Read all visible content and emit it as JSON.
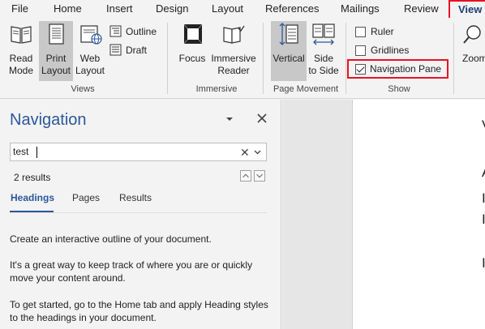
{
  "ribbon_tabs": [
    "File",
    "Home",
    "Insert",
    "Design",
    "Layout",
    "References",
    "Mailings",
    "Review",
    "View"
  ],
  "ribbon": {
    "views": {
      "label": "Views",
      "read_mode": [
        "Read",
        "Mode"
      ],
      "print_layout": [
        "Print",
        "Layout"
      ],
      "web_layout": [
        "Web",
        "Layout"
      ],
      "outline": "Outline",
      "draft": "Draft"
    },
    "immersive": {
      "label": "Immersive",
      "focus": "Focus",
      "immersive_reader": [
        "Immersive",
        "Reader"
      ]
    },
    "page_movement": {
      "label": "Page Movement",
      "vertical": "Vertical",
      "side_to_side": [
        "Side",
        "to Side"
      ]
    },
    "show": {
      "label": "Show",
      "ruler": {
        "label": "Ruler",
        "checked": false
      },
      "gridlines": {
        "label": "Gridlines",
        "checked": false
      },
      "navigation_pane": {
        "label": "Navigation Pane",
        "checked": true
      }
    },
    "zoom": "Zoom"
  },
  "nav_pane": {
    "title": "Navigation",
    "search_value": "test",
    "results_count": "2 results",
    "tabs": [
      "Headings",
      "Pages",
      "Results"
    ],
    "active_tab": "Headings",
    "paragraphs": [
      "Create an interactive outline of your document.",
      "It's a great way to keep track of where you are or quickly move your content around.",
      "To get started, go to the Home tab and apply Heading styles to the headings in your document."
    ]
  },
  "document_visible_chars": [
    "V",
    "A",
    "I",
    "I",
    "I"
  ],
  "colors": {
    "accent": "#2b579a",
    "highlight": "#e81123"
  }
}
